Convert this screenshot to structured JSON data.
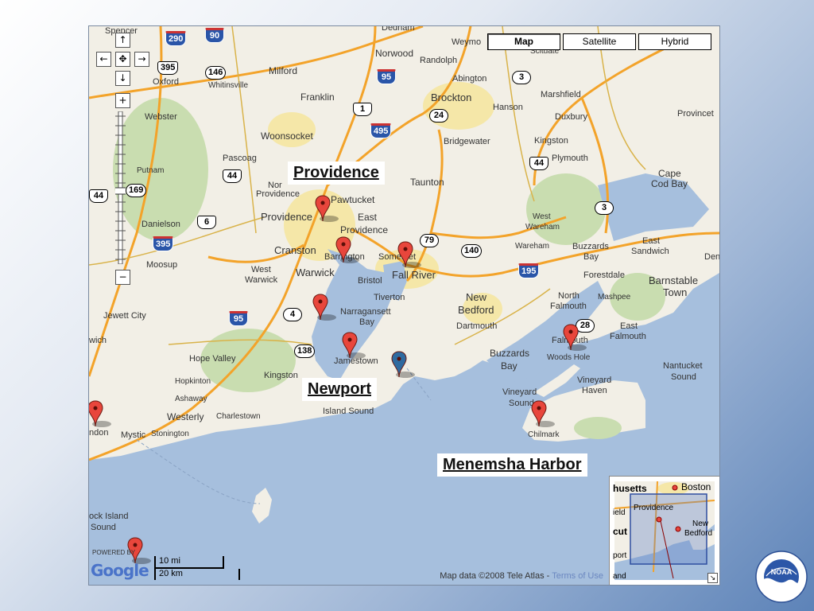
{
  "map_type_buttons": [
    "Map",
    "Satellite",
    "Hybrid"
  ],
  "active_map_type": "Map",
  "callouts": {
    "providence": "Providence",
    "newport": "Newport",
    "menemsha": "Menemsha Harbor"
  },
  "place_labels": {
    "spencer": "Spencer",
    "dedham": "Dedham",
    "weymouth": "Weymo",
    "scituate": "Scituate",
    "oxford": "Oxford",
    "whitinsville": "Whitinsville",
    "milford": "Milford",
    "norwood": "Norwood",
    "randolph": "Randolph",
    "abington": "Abington",
    "webster": "Webster",
    "franklin": "Franklin",
    "brockton": "Brockton",
    "hanson": "Hanson",
    "marshfield": "Marshfield",
    "duxbury": "Duxbury",
    "provincetown": "Provincet",
    "woonsocket": "Woonsocket",
    "bridgewater": "Bridgewater",
    "kingston_ma": "Kingston",
    "plymouth": "Plymouth",
    "pascoag": "Pascoag",
    "putnam": "Putnam",
    "taunton": "Taunton",
    "cape_cod_bay_1": "Cape",
    "cape_cod_bay_2": "Cod Bay",
    "north_providence_1": "Nor",
    "north_providence_2": "Providence",
    "pawtucket": "Pawtucket",
    "providence_city": "Providence",
    "east_providence_1": "East",
    "east_providence_2": "Providence",
    "danielson": "Danielson",
    "cranston": "Cranston",
    "barrington": "Barrington",
    "somerset": "Somerset",
    "fall_river": "Fall River",
    "west_wareham_1": "West",
    "west_wareham_2": "Wareham",
    "wareham": "Wareham",
    "buzzards_bay_town_1": "Buzzards",
    "buzzards_bay_town_2": "Bay",
    "east_sandwich_1": "East",
    "east_sandwich_2": "Sandwich",
    "moosup": "Moosup",
    "west_warwick_1": "West",
    "west_warwick_2": "Warwick",
    "warwick": "Warwick",
    "bristol": "Bristol",
    "forestdale": "Forestdale",
    "barnstable_1": "Barnstable",
    "barnstable_2": "Town",
    "dennis": "Den",
    "tiverton": "Tiverton",
    "new_bedford_1": "New",
    "new_bedford_2": "Bedford",
    "mashpee": "Mashpee",
    "jewett_city": "Jewett City",
    "narragansett_1": "Narragansett",
    "narragansett_2": "Bay",
    "north_falmouth_1": "North",
    "north_falmouth_2": "Falmouth",
    "dartmouth": "Dartmouth",
    "east_falmouth_1": "East",
    "east_falmouth_2": "Falmouth",
    "falmouth": "Falmouth",
    "norwich": "wich",
    "hope_valley": "Hope Valley",
    "jamestown": "Jamestown",
    "buzzards_bay_1": "Buzzards",
    "buzzards_bay_2": "Bay",
    "woods_hole": "Woods Hole",
    "kingston_ri": "Kingston",
    "nantucket_sound_1": "Nantucket",
    "nantucket_sound_2": "Sound",
    "hopkinton": "Hopkinton",
    "ashaway": "Ashaway",
    "vineyard_haven_1": "Vineyard",
    "vineyard_haven_2": "Haven",
    "vineyard_sound_1": "Vineyard",
    "vineyard_sound_2": "Sound",
    "westerly": "Westerly",
    "charlestown": "Charlestown",
    "island_sound": "Island Sound",
    "london": "ndon",
    "mystic": "Mystic",
    "stonington": "Stonington",
    "chilmark": "Chilmark",
    "block_island_1": "ock Island",
    "block_island_2": "Sound"
  },
  "highway_shields": {
    "i290": "290",
    "i90": "90",
    "us395_n": "395",
    "r146": "146",
    "i95_n": "95",
    "r3": "3",
    "r1": "1",
    "i495": "495",
    "r24": "24",
    "r44_ri": "44",
    "r44_ma": "44",
    "r44_w": "44",
    "r169": "169",
    "r6": "6",
    "us395_s": "395",
    "r3_cape": "3",
    "r79": "79",
    "r140": "140",
    "i195": "195",
    "i95_s": "95",
    "r4": "4",
    "r138": "138",
    "r28": "28"
  },
  "inset_labels": {
    "boston": "Boston",
    "massachusetts": "husetts",
    "providence": "Providence",
    "new_bedford_1": "New",
    "new_bedford_2": "Bedford",
    "field": "ield",
    "cut": "cut",
    "port": "port",
    "land": "and"
  },
  "scale": {
    "miles": "10 mi",
    "km": "20 km"
  },
  "copyright": "Map data ©2008 Tele Atlas - ",
  "terms": "Terms of Use",
  "powered_by": "POWERED BY",
  "google_logo": "Google",
  "logo_text": "NOAA",
  "colors": {
    "water": "#a6bfdd",
    "land": "#f2efe6",
    "urban": "#f5e7a8",
    "forest": "#c9ddb0",
    "highway": "#f3a32a",
    "marker": "#e8463c",
    "marker_blue": "#2f6aa0"
  }
}
